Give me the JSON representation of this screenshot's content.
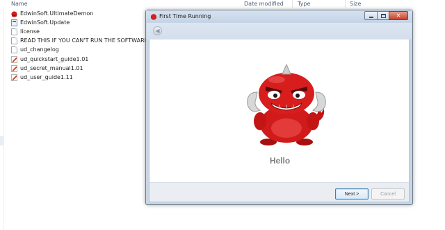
{
  "explorer": {
    "columns": {
      "name": "Name",
      "date_modified": "Date modified",
      "type": "Type",
      "size": "Size"
    },
    "files": [
      {
        "name": "EdwinSoft.UltimateDemon",
        "icon": "demon-app-icon"
      },
      {
        "name": "EdwinSoft.Update",
        "icon": "executable-icon"
      },
      {
        "name": "license",
        "icon": "text-file-icon"
      },
      {
        "name": "READ THIS IF YOU CAN'T RUN THE SOFTWARE",
        "icon": "text-file-icon"
      },
      {
        "name": "ud_changelog",
        "icon": "text-file-icon"
      },
      {
        "name": "ud_quickstart_guide1.01",
        "icon": "pdf-file-icon"
      },
      {
        "name": "ud_secret_manual1.01",
        "icon": "pdf-file-icon"
      },
      {
        "name": "ud_user_guide1.11",
        "icon": "pdf-file-icon"
      }
    ]
  },
  "dialog": {
    "title": "First Time Running",
    "greeting": "Hello",
    "next_label": "Next >",
    "cancel_label": "Cancel",
    "close_glyph": "✕",
    "back_glyph": "◀",
    "mascot_icon": "red-demon-mascot"
  },
  "colors": {
    "title_bar": "#c9d5e3",
    "greeting_text": "#7f7f7f",
    "mascot_red": "#d81d1d"
  }
}
